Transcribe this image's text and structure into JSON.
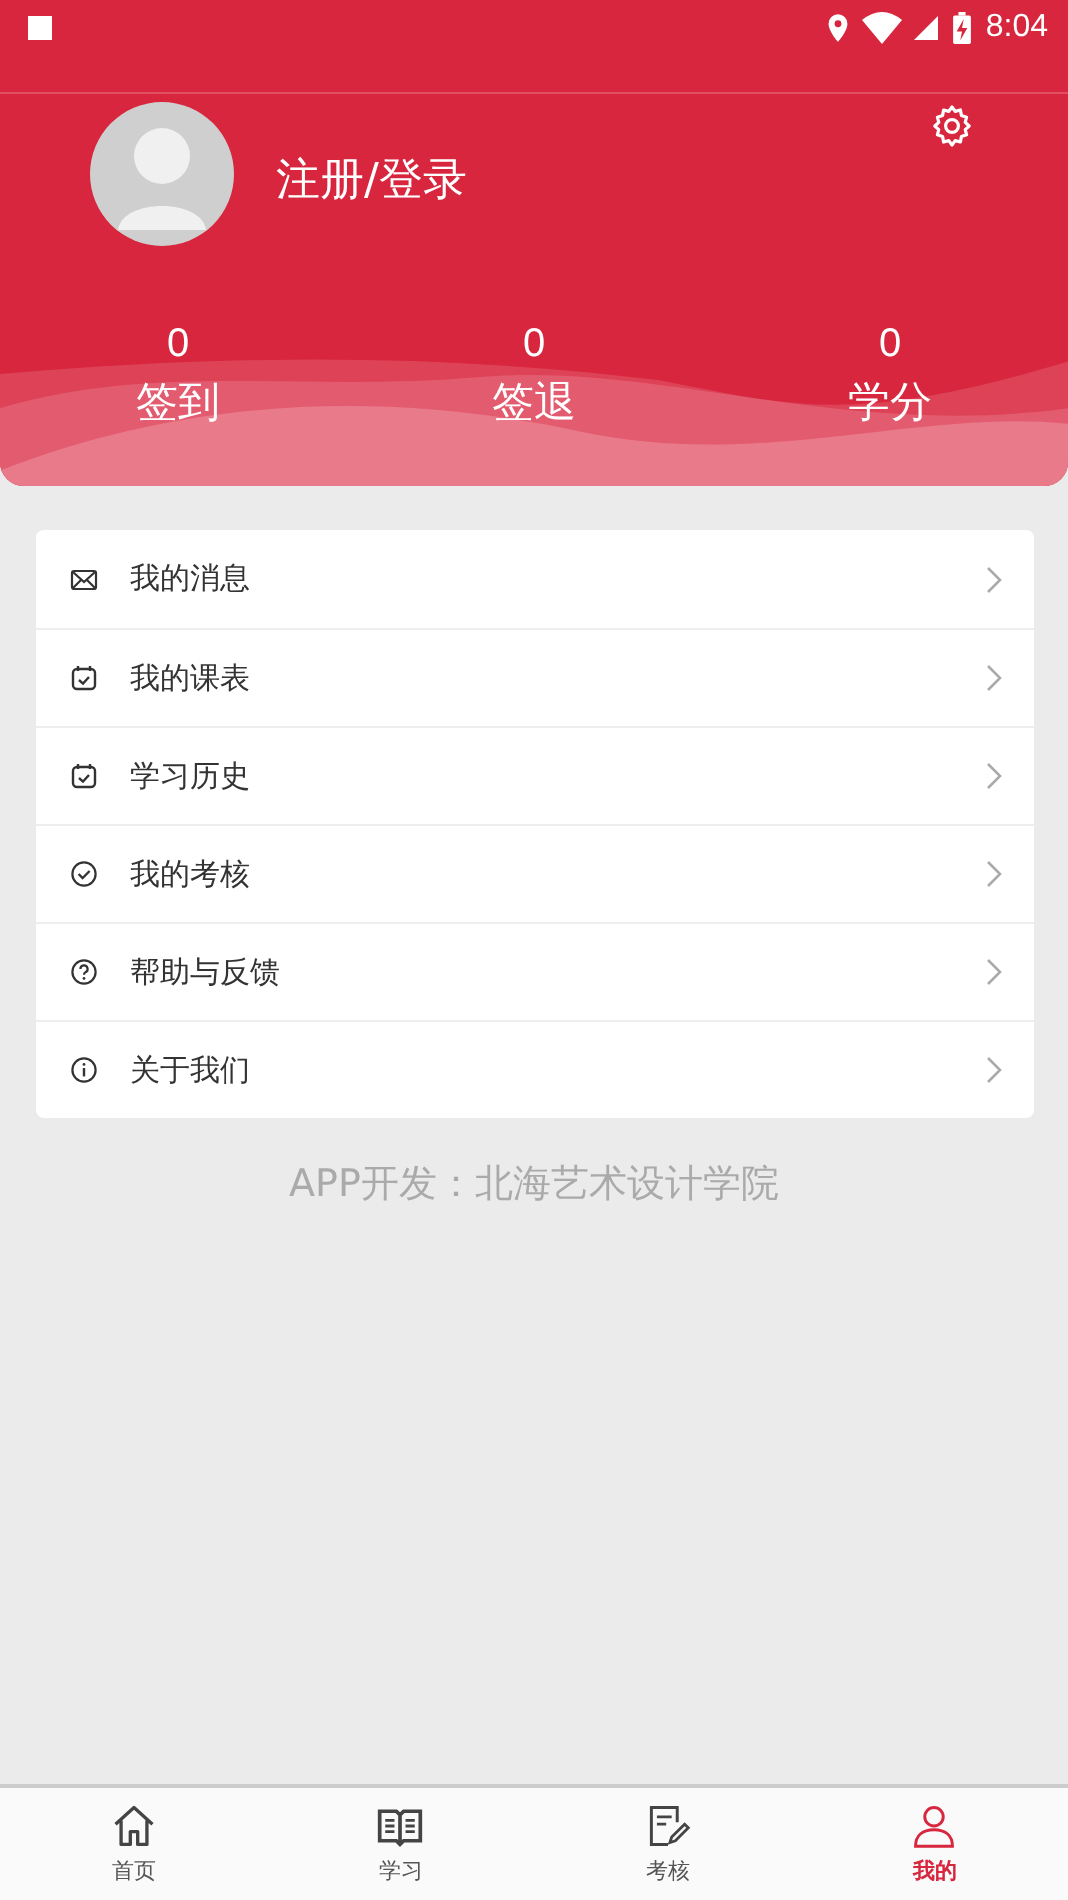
{
  "status_bar": {
    "time": "8:04"
  },
  "profile": {
    "login_label": "注册/登录"
  },
  "stats": [
    {
      "value": "0",
      "label": "签到"
    },
    {
      "value": "0",
      "label": "签退"
    },
    {
      "value": "0",
      "label": "学分"
    }
  ],
  "menu": [
    {
      "label": "我的消息"
    },
    {
      "label": "我的课表"
    },
    {
      "label": "学习历史"
    },
    {
      "label": "我的考核"
    },
    {
      "label": "帮助与反馈"
    },
    {
      "label": "关于我们"
    }
  ],
  "footer_note": "APP开发：北海艺术设计学院",
  "bottom_nav": [
    {
      "label": "首页",
      "selected": false
    },
    {
      "label": "学习",
      "selected": false
    },
    {
      "label": "考核",
      "selected": false
    },
    {
      "label": "我的",
      "selected": true
    }
  ]
}
